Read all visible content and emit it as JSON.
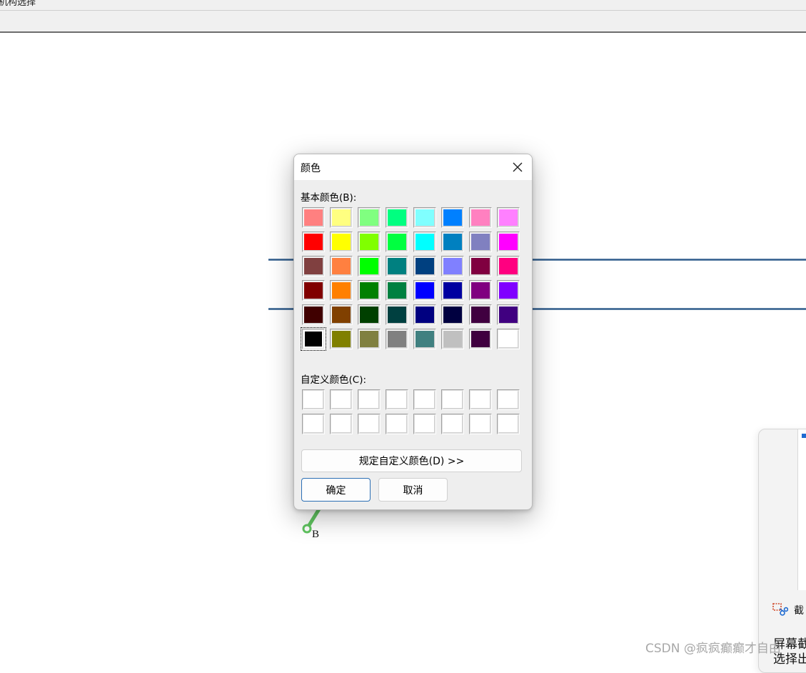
{
  "app": {
    "title_fragment": "机构选择"
  },
  "canvas": {
    "point_label": "B",
    "line_color": "#2f5c8c",
    "segment_color": "#5fc45f"
  },
  "dialog": {
    "title": "颜色",
    "basic_colors_label": "基本颜色(B):",
    "basic_colors": [
      "#ff8080",
      "#ffff80",
      "#80ff80",
      "#00ff80",
      "#80ffff",
      "#0080ff",
      "#ff80c0",
      "#ff80ff",
      "#ff0000",
      "#ffff00",
      "#80ff00",
      "#00ff40",
      "#00ffff",
      "#0080c0",
      "#8080c0",
      "#ff00ff",
      "#804040",
      "#ff8040",
      "#00ff00",
      "#008080",
      "#004080",
      "#8080ff",
      "#800040",
      "#ff0080",
      "#800000",
      "#ff8000",
      "#008000",
      "#008040",
      "#0000ff",
      "#0000a0",
      "#800080",
      "#8000ff",
      "#400000",
      "#804000",
      "#004000",
      "#004040",
      "#000080",
      "#000040",
      "#400040",
      "#400080",
      "#000000",
      "#808000",
      "#808040",
      "#808080",
      "#408080",
      "#c0c0c0",
      "#400040",
      "#ffffff"
    ],
    "selected_index": 40,
    "custom_colors_label": "自定义颜色(C):",
    "custom_colors": [
      "#ffffff",
      "#ffffff",
      "#ffffff",
      "#ffffff",
      "#ffffff",
      "#ffffff",
      "#ffffff",
      "#ffffff",
      "#ffffff",
      "#ffffff",
      "#ffffff",
      "#ffffff",
      "#ffffff",
      "#ffffff",
      "#ffffff",
      "#ffffff"
    ],
    "define_custom_button": "规定自定义颜色(D) >>",
    "ok_button": "确定",
    "cancel_button": "取消"
  },
  "side_panel": {
    "item_label": "截",
    "text_line1": "屏幕截",
    "text_line2": "选择出"
  },
  "watermark": "CSDN @疯疯癫癫才自由"
}
